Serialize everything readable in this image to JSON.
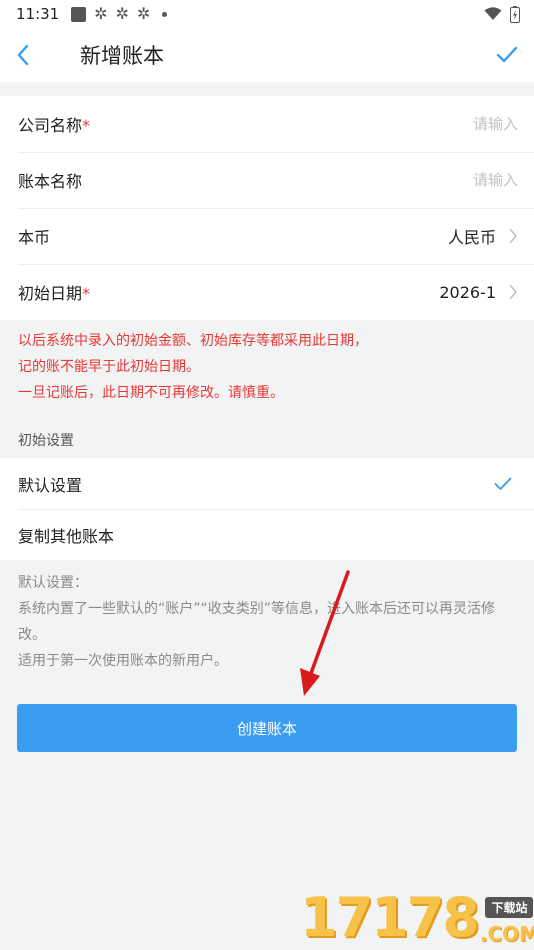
{
  "status_bar": {
    "time": "11:31",
    "icons": [
      "photo-icon",
      "gear-icon",
      "gear-icon",
      "gear-icon",
      "dot-icon"
    ],
    "right_icons": [
      "wifi-icon",
      "battery-icon"
    ]
  },
  "app_bar": {
    "title": "新增账本",
    "back_icon": "chevron-left-icon",
    "confirm_icon": "check-icon"
  },
  "form": {
    "company": {
      "label": "公司名称",
      "required": "*",
      "placeholder": "请输入"
    },
    "book": {
      "label": "账本名称",
      "placeholder": "请输入"
    },
    "currency": {
      "label": "本币",
      "value": "人民币"
    },
    "start_date": {
      "label": "初始日期",
      "required": "*",
      "value": "2026-1"
    }
  },
  "warning": {
    "line1": "以后系统中录入的初始金额、初始库存等都采用此日期，",
    "line2": "记的账不能早于此初始日期。",
    "line3": "一旦记账后，此日期不可再修改。请慎重。"
  },
  "init_settings": {
    "heading": "初始设置",
    "options": [
      {
        "label": "默认设置",
        "selected": true
      },
      {
        "label": "复制其他账本",
        "selected": false
      }
    ]
  },
  "description": {
    "line1": "默认设置：",
    "line2a": "系统内置了一些默认的“账户”“收支类别”等信息，进入账本后还可以再灵活修",
    "line2b": "改。",
    "line3": "适用于第一次使用账本的新用户。"
  },
  "create_button": {
    "label": "创建账本"
  },
  "watermark": {
    "number": "17178",
    "badge": "下载站",
    "suffix": ".COM"
  },
  "colors": {
    "accent": "#3a9df1",
    "warning": "#e53935",
    "annotation_arrow": "#d81b1b"
  }
}
